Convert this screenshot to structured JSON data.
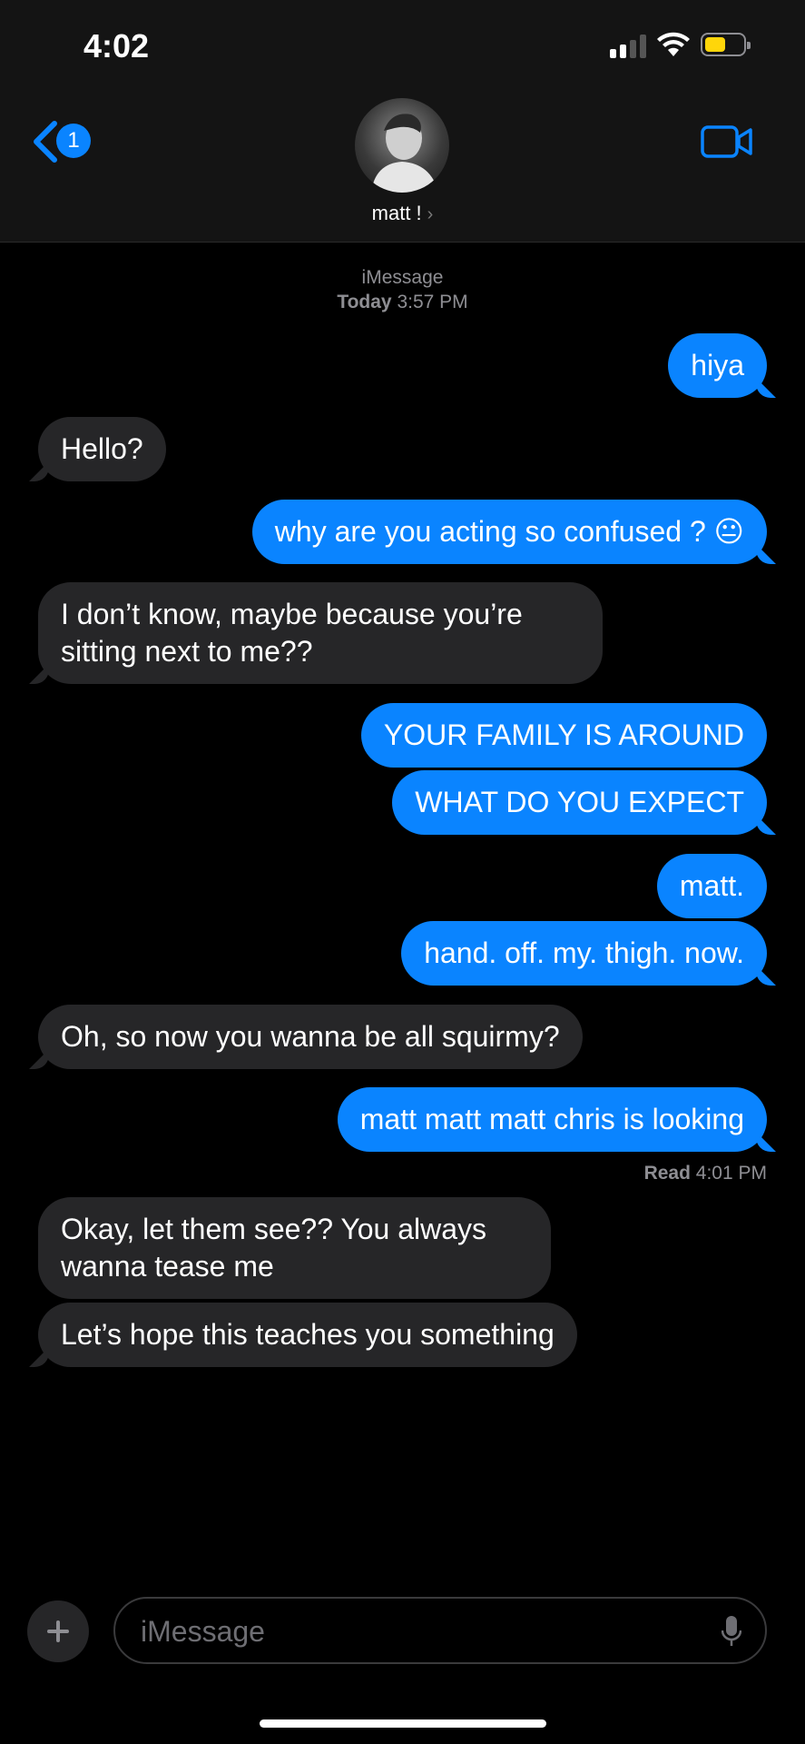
{
  "status": {
    "time": "4:02"
  },
  "header": {
    "back_badge": "1",
    "contact_name": "matt !"
  },
  "thread": {
    "service": "iMessage",
    "date_label": "Today",
    "date_time": "3:57 PM",
    "messages": [
      {
        "dir": "sent",
        "text": "hiya"
      },
      {
        "dir": "recv",
        "text": "Hello?"
      },
      {
        "dir": "sent",
        "text": "why are you acting so confused ?",
        "emoji": "😐"
      },
      {
        "dir": "recv",
        "text": "I don’t know, maybe because you’re sitting next to me??"
      },
      {
        "dir": "sent",
        "text": "YOUR FAMILY IS AROUND"
      },
      {
        "dir": "sent",
        "text": "WHAT DO YOU EXPECT"
      },
      {
        "dir": "sent",
        "text": "matt."
      },
      {
        "dir": "sent",
        "text": "hand. off. my. thigh. now."
      },
      {
        "dir": "recv",
        "text": "Oh, so now you wanna be all squirmy?"
      },
      {
        "dir": "sent",
        "text": "matt matt matt chris is looking"
      },
      {
        "dir": "recv",
        "text": "Okay, let them see?? You always wanna tease me"
      },
      {
        "dir": "recv",
        "text": "Let’s hope this teaches you something"
      }
    ],
    "read_label": "Read",
    "read_time": "4:01 PM"
  },
  "input": {
    "placeholder": "iMessage"
  },
  "colors": {
    "sent": "#0a84ff",
    "received": "#262628",
    "background": "#000000",
    "battery": "#ffd60a"
  },
  "icons": [
    "back-chevron-icon",
    "video-camera-icon",
    "plus-icon",
    "microphone-icon",
    "signal-icon",
    "wifi-icon",
    "battery-icon"
  ]
}
